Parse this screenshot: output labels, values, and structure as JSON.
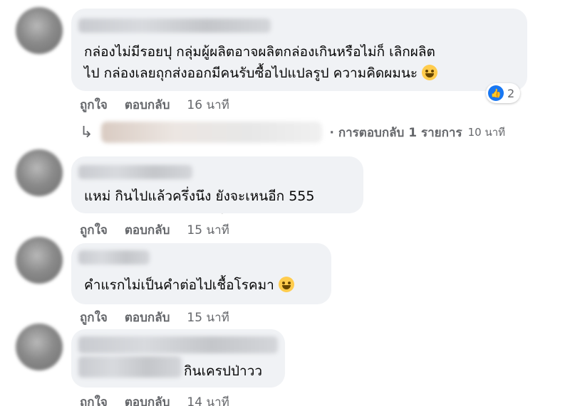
{
  "comments": [
    {
      "lines": [
        "กล่องไม่มีรอยปุ กลุ่มผู้ผลิตอาจผลิตกล่องเกินหรือไม่ก็ เลิกผลิต",
        "ไป กล่องเลยถุกส่งออกมีคนรับซื้อไปแปลรูป ความคิดผมนะ"
      ],
      "like_label": "ถูกใจ",
      "reply_label": "ตอบกลับ",
      "time": "16 นาที",
      "reaction_count": "2"
    },
    {
      "lines": [
        "แหม่ กินไปแล้วครึ่งนึง ยังจะเหนอีก 555"
      ],
      "like_label": "ถูกใจ",
      "reply_label": "ตอบกลับ",
      "time": "15 นาที"
    },
    {
      "lines": [
        "คำแรกไม่เป็นคำต่อไปเชื้อโรคมา"
      ],
      "like_label": "ถูกใจ",
      "reply_label": "ตอบกลับ",
      "time": "15 นาที"
    },
    {
      "lines": [
        "กินเครปป่าวว"
      ],
      "like_label": "ถูกใจ",
      "reply_label": "ตอบกลับ",
      "time": "14 นาที"
    }
  ],
  "reply_thread": {
    "summary": "· การตอบกลับ 1 รายการ",
    "time": "10 นาที"
  },
  "icons": {
    "reply_arrow": "reply-arrow-icon",
    "like": "like-icon",
    "emoji_1": "grinning-sweat-emoji",
    "emoji_2": "rofl-emoji"
  },
  "colors": {
    "bubble": "#f0f2f5",
    "meta_text": "#65676b",
    "like_blue": "#1877f2"
  }
}
